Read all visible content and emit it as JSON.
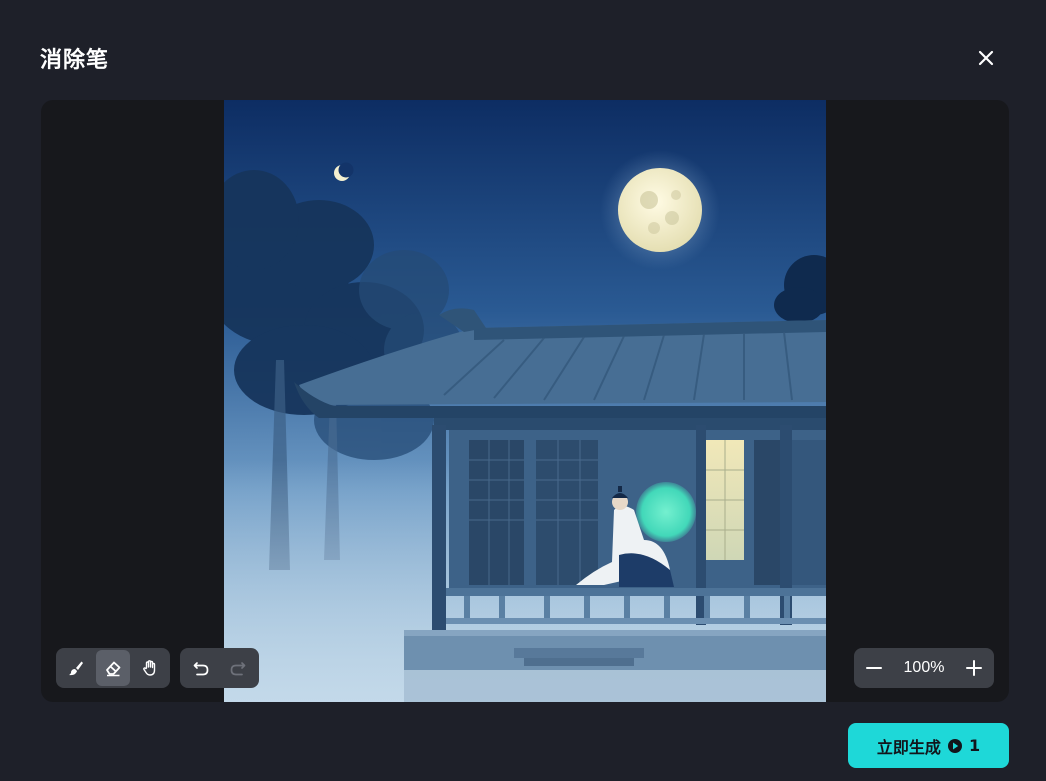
{
  "dialog": {
    "title": "消除笔"
  },
  "toolbar": {
    "tools": [
      {
        "icon": "brush-icon"
      },
      {
        "icon": "eraser-icon",
        "active": true
      },
      {
        "icon": "hand-icon"
      }
    ],
    "history": [
      {
        "icon": "undo-icon"
      },
      {
        "icon": "redo-icon",
        "disabled": true
      }
    ]
  },
  "zoom": {
    "value": "100%"
  },
  "generate": {
    "label": "立即生成",
    "cost": "1"
  },
  "colors": {
    "accent": "#1ed8d8",
    "background": "#1e2029",
    "canvas": "#17181c",
    "toolbar": "#3d4047"
  }
}
